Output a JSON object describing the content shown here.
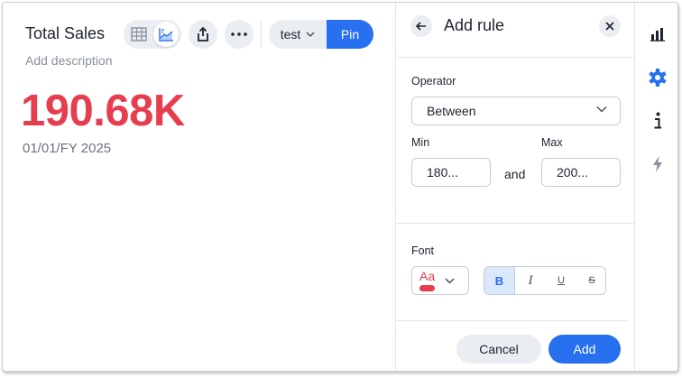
{
  "viz": {
    "title": "Total Sales",
    "description_placeholder": "Add description",
    "kpi_value": "190.68K",
    "kpi_date": "01/01/FY 2025",
    "kpi_color": "#e63e4e"
  },
  "toolbar": {
    "view_table_icon": "table-icon",
    "view_chart_icon": "chart-icon",
    "share_icon": "share-icon",
    "more_icon": "more-icon",
    "liveboard_label": "test",
    "pin_label": "Pin",
    "accent_color": "#2770ef"
  },
  "panel": {
    "title": "Add rule",
    "operator_label": "Operator",
    "operator_value": "Between",
    "min_label": "Min",
    "max_label": "Max",
    "min_value": "180...",
    "max_value": "200...",
    "and_text": "and",
    "font_label": "Font",
    "font_sample": "Aa",
    "font_color": "#e63e4e",
    "bold_label": "B",
    "italic_label": "I",
    "underline_label": "U",
    "strike_label": "S",
    "cancel_label": "Cancel",
    "add_label": "Add"
  },
  "sidebar": {
    "items": [
      "chart-type-icon",
      "settings-icon",
      "info-icon",
      "lightning-icon"
    ]
  }
}
